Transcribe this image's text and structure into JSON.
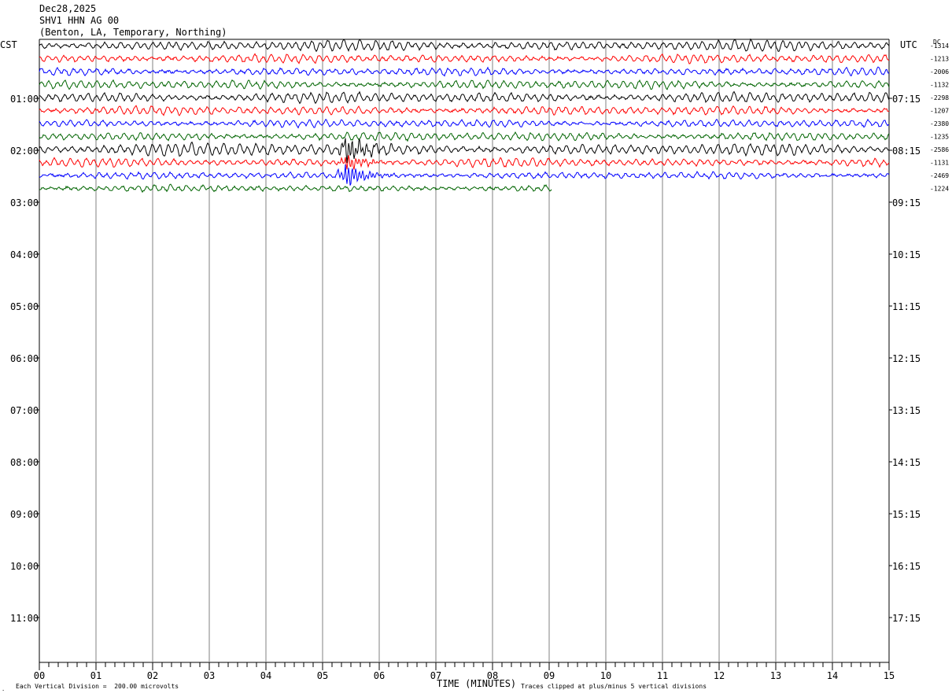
{
  "header": {
    "date": "Dec28,2025",
    "station": "SHV1 HHN AG 00",
    "location": "(Benton, LA, Temporary, Northing)"
  },
  "left_tz": "CST",
  "right_tz": "UTC",
  "dc_label": "DC",
  "footer": {
    "scale_note": "Each Vertical Division =  200.00 microvolts",
    "xlabel": "TIME (MINUTES)",
    "clip_note": "Traces clipped at plus/minus 5 vertical divisions"
  },
  "colors": {
    "black": "#000000",
    "red": "#ff0000",
    "blue": "#0000ff",
    "green": "#006400",
    "grid": "#808080"
  },
  "chart_data": {
    "type": "line",
    "title": "SHV1 HHN AG 00",
    "xlabel": "TIME (MINUTES)",
    "xlim": [
      0,
      15
    ],
    "x_ticks": [
      "00",
      "01",
      "02",
      "03",
      "04",
      "05",
      "06",
      "07",
      "08",
      "09",
      "10",
      "11",
      "12",
      "13",
      "14",
      "15"
    ],
    "left_hour_labels": [
      "01:00",
      "02:00",
      "03:00",
      "04:00",
      "05:00",
      "06:00",
      "07:00",
      "08:00",
      "09:00",
      "10:00",
      "11:00"
    ],
    "right_hour_labels": [
      "07:15",
      "08:15",
      "09:15",
      "10:15",
      "11:15",
      "12:15",
      "13:15",
      "14:15",
      "15:15",
      "16:15",
      "17:15"
    ],
    "trace_color_cycle": [
      "black",
      "red",
      "blue",
      "green"
    ],
    "traces": [
      {
        "dc": "-1314",
        "color": "black",
        "end_minute": 15,
        "amplitude": 1.0
      },
      {
        "dc": "-1213",
        "color": "red",
        "end_minute": 15,
        "amplitude": 0.8
      },
      {
        "dc": "-2006",
        "color": "blue",
        "end_minute": 15,
        "amplitude": 0.7
      },
      {
        "dc": "-1132",
        "color": "green",
        "end_minute": 15,
        "amplitude": 0.8
      },
      {
        "dc": "-2298",
        "color": "black",
        "end_minute": 15,
        "amplitude": 1.0
      },
      {
        "dc": "-1207",
        "color": "red",
        "end_minute": 15,
        "amplitude": 0.8
      },
      {
        "dc": "-2380",
        "color": "blue",
        "end_minute": 15,
        "amplitude": 0.7
      },
      {
        "dc": "-1235",
        "color": "green",
        "end_minute": 15,
        "amplitude": 0.8
      },
      {
        "dc": "-2586",
        "color": "black",
        "end_minute": 15,
        "amplitude": 1.1
      },
      {
        "dc": "-1131",
        "color": "red",
        "end_minute": 15,
        "amplitude": 0.8
      },
      {
        "dc": "-2469",
        "color": "blue",
        "end_minute": 15,
        "amplitude": 0.6
      },
      {
        "dc": "-1224",
        "color": "green",
        "end_minute": 9.05,
        "amplitude": 0.6
      }
    ],
    "event": {
      "minute": 5.4,
      "trace_index": 9
    }
  }
}
